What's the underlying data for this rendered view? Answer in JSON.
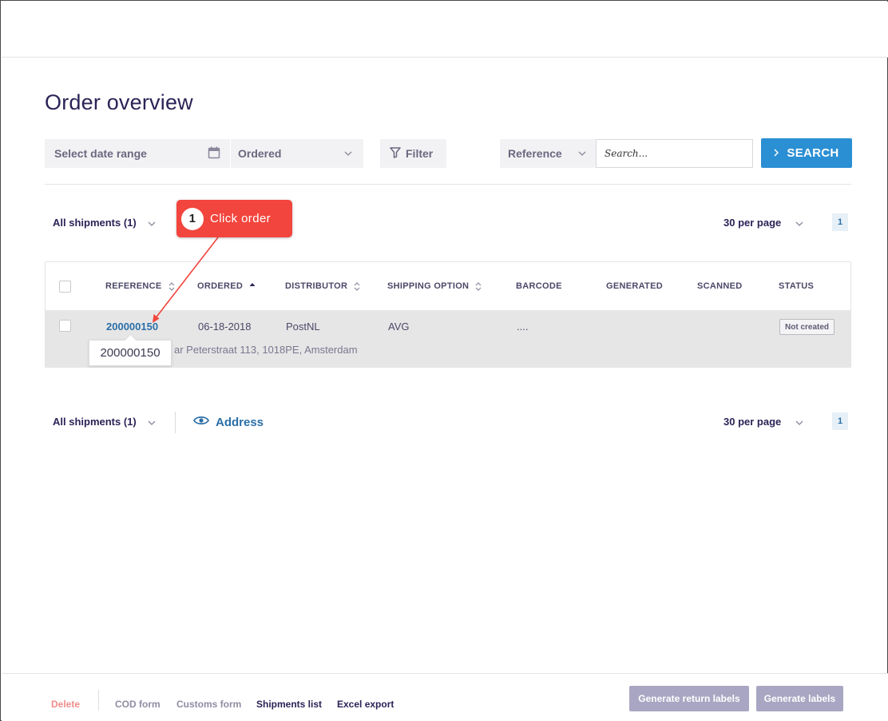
{
  "page": {
    "title": "Order overview"
  },
  "toolbar": {
    "date_range_placeholder": "Select date range",
    "ordered_value": "Ordered",
    "filter_label": "Filter",
    "search_field_value": "Reference",
    "search_placeholder": "Search...",
    "search_button_label": "SEARCH"
  },
  "pagination_top": {
    "shipments_label": "All shipments (1)",
    "per_page": "30 per page",
    "page": "1"
  },
  "callout": {
    "number": "1",
    "text": "Click order"
  },
  "table": {
    "headers": {
      "reference": "REFERENCE",
      "ordered": "ORDERED",
      "distributor": "DISTRIBUTOR",
      "shipping_option": "SHIPPING OPTION",
      "barcode": "BARCODE",
      "generated": "GENERATED",
      "scanned": "SCANNED",
      "status": "STATUS"
    },
    "row": {
      "reference": "200000150",
      "ordered": "06-18-2018",
      "distributor": "PostNL",
      "shipping_option": "AVG",
      "barcode": "....",
      "status": "Not created",
      "address": "ar Peterstraat 113, 1018PE, Amsterdam"
    },
    "tooltip": "200000150"
  },
  "pagination_bottom": {
    "shipments_label": "All shipments (1)",
    "address_toggle": "Address",
    "per_page": "30 per page",
    "page": "1"
  },
  "footer": {
    "delete": "Delete",
    "cod_form": "COD form",
    "customs_form": "Customs form",
    "shipments_list": "Shipments list",
    "excel_export": "Excel export",
    "generate_return_labels": "Generate return labels",
    "generate_labels": "Generate labels"
  },
  "colors": {
    "accent": "#2b8fd4",
    "link": "#2b6fa8",
    "title": "#2a2457",
    "callout": "#f2453d",
    "delete": "#f28b8b",
    "disabled_button": "#a8a6c2"
  }
}
